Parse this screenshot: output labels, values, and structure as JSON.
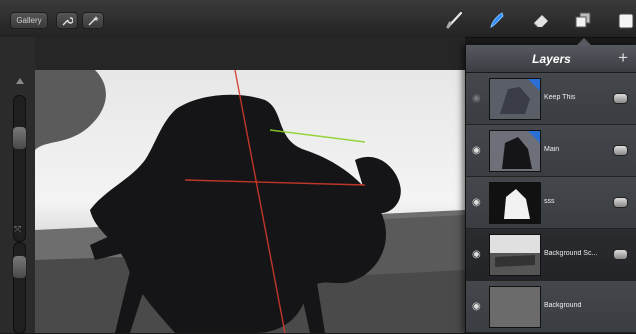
{
  "toolbar": {
    "gallery_label": "Gallery",
    "left_icons": [
      "wrench-icon",
      "magic-wand-icon"
    ],
    "right_icons": [
      "brush-icon",
      "smudge-icon",
      "eraser-icon",
      "layers-icon",
      "color-swatch-icon"
    ],
    "active_tool": "smudge-icon",
    "accent": "#2f8bff"
  },
  "layers_panel": {
    "title": "Layers",
    "add_icon": "plus-icon",
    "layers": [
      {
        "name": "Keep This",
        "visible": false,
        "selected": false,
        "has_badge": true
      },
      {
        "name": "Main",
        "visible": true,
        "selected": false,
        "has_badge": true
      },
      {
        "name": "sss",
        "visible": true,
        "selected": false,
        "has_badge": false
      },
      {
        "name": "Background Sc...",
        "visible": true,
        "selected": true,
        "has_badge": false
      },
      {
        "name": "Background",
        "visible": true,
        "selected": false,
        "has_badge": false
      }
    ]
  },
  "canvas": {
    "subject": "dark robot silhouette painting",
    "guide_colors": [
      "#d23a2a",
      "#8dd12a"
    ]
  }
}
